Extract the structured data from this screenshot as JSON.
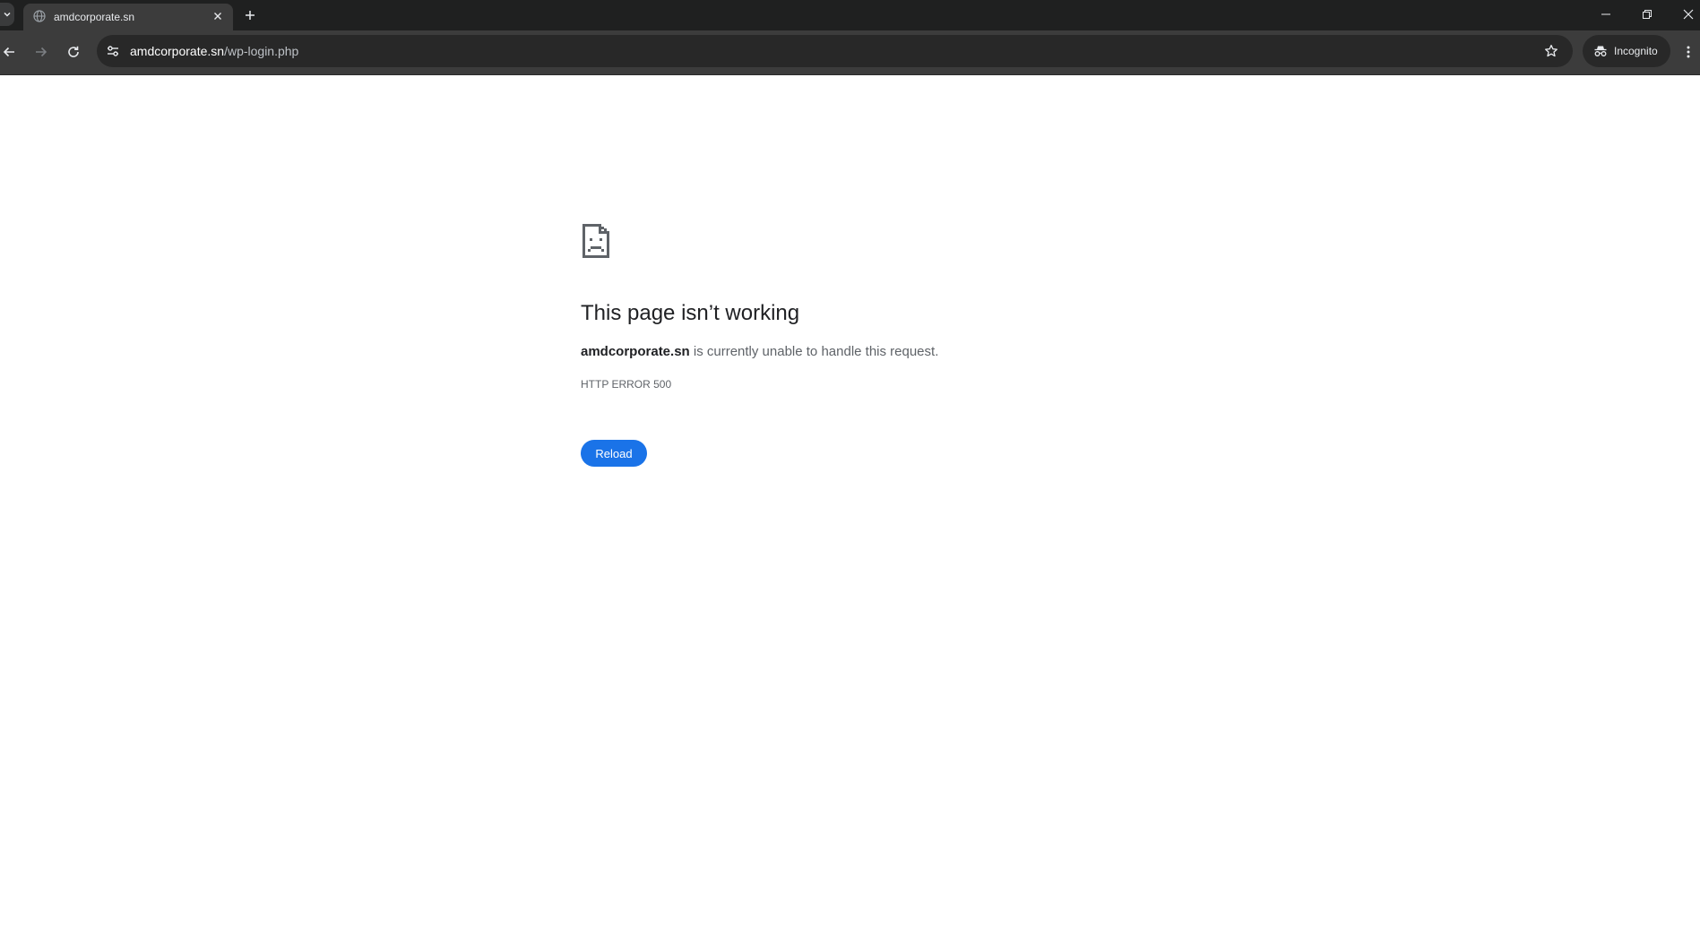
{
  "browser": {
    "tab": {
      "title": "amdcorporate.sn",
      "favicon": "globe-icon"
    },
    "window_controls": [
      "minimize-icon",
      "restore-icon",
      "close-icon"
    ],
    "toolbar": {
      "url_domain": "amdcorporate.sn",
      "url_path": "/wp-login.php",
      "incognito_label": "Incognito"
    },
    "colors": {
      "tabstrip_bg": "#1f2020",
      "toolbar_bg": "#3c3c3c",
      "omnibox_bg": "#282828",
      "accent": "#1a73e8"
    }
  },
  "page": {
    "icon": "sad-document-icon",
    "title": "This page isn’t working",
    "host": "amdcorporate.sn",
    "message": " is currently unable to handle this request.",
    "error_code": "HTTP ERROR 500",
    "reload_label": "Reload"
  }
}
